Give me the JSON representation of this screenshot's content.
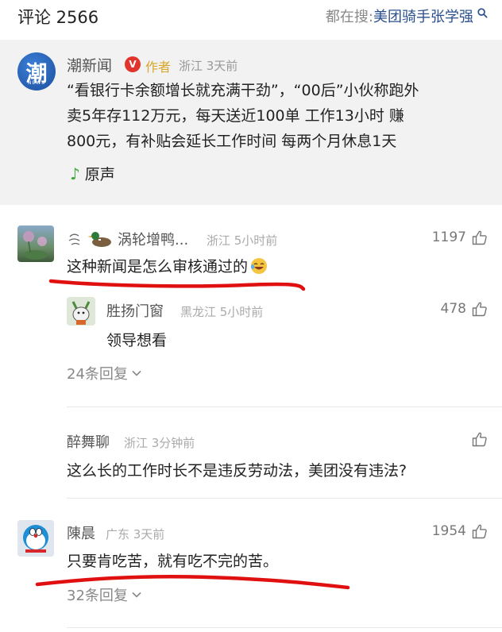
{
  "header": {
    "comment_count": "评论 2566",
    "search_prefix": "都在搜: ",
    "search_keyword": "美团骑手张学强"
  },
  "post": {
    "logo_text": "潮",
    "logo_sub": "NEWS",
    "author_name": "潮新闻",
    "verified_badge": "V",
    "author_tag": "作者",
    "meta": "浙江 3天前",
    "body_lines": [
      "“看银行卡余额增长就充满干劲”，“00后”小伙称跑外",
      "卖5年存112万元，每天送近100单 工作13小时 赚",
      "800元，有补贴会延长工作时间 每两个月休息1天"
    ],
    "voice_label": "原声"
  },
  "comments": [
    {
      "user": "涡轮增鸭...",
      "meta": "浙江 5小时前",
      "likes": "1197",
      "text": "这种新闻是怎么审核通过的",
      "reply": {
        "user": "胜扬门窗",
        "meta": "黑龙江 5小时前",
        "likes": "478",
        "text": "领导想看"
      },
      "replies_label": "24条回复"
    },
    {
      "user": "醉舞聊",
      "meta": "浙江 3分钟前",
      "likes": "",
      "text": "这么长的工作时长不是违反劳动法，美团没有违法?"
    },
    {
      "user": "陳晨",
      "meta": "广东 3天前",
      "likes": "1954",
      "text": "只要肯吃苦，就有吃不完的苦。",
      "replies_label": "32条回复"
    }
  ],
  "colors": {
    "link_blue": "#2a4f8f",
    "author_gold": "#d9a62a",
    "verified_red": "#e0342c",
    "annotation_red": "#e01010",
    "post_bg": "#f2f2f2"
  },
  "icons": [
    "search-icon",
    "music-note-icon",
    "thumbs-up-icon",
    "chevron-down-icon",
    "laugh-emoji-icon",
    "duck-icon"
  ]
}
